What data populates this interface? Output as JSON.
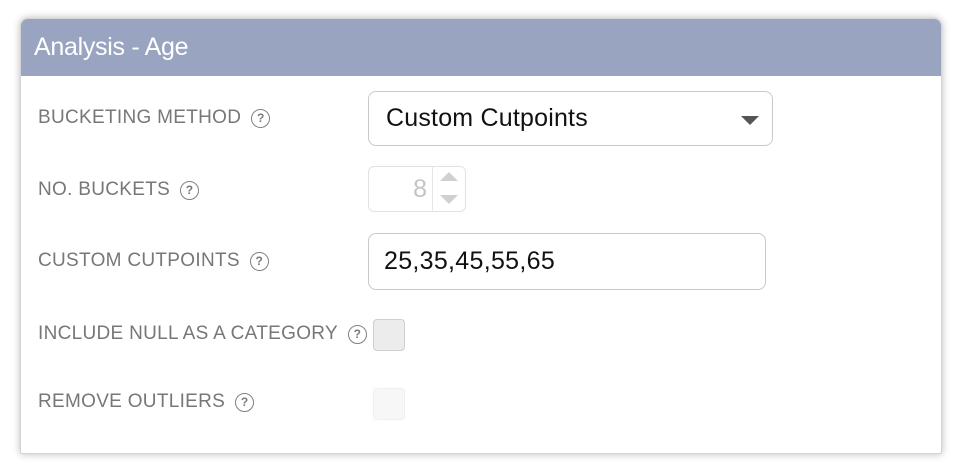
{
  "panel": {
    "title": "Analysis - Age"
  },
  "fields": {
    "bucketing_method": {
      "label": "BUCKETING METHOD",
      "help_glyph": "?",
      "value": "Custom Cutpoints"
    },
    "no_buckets": {
      "label": "NO. BUCKETS",
      "help_glyph": "?",
      "value": "8",
      "disabled": true
    },
    "custom_cutpoints": {
      "label": "CUSTOM CUTPOINTS",
      "help_glyph": "?",
      "value": "25,35,45,55,65"
    },
    "include_null": {
      "label": "INCLUDE NULL AS A CATEGORY",
      "help_glyph": "?",
      "checked": false
    },
    "remove_outliers": {
      "label": "REMOVE OUTLIERS",
      "help_glyph": "?",
      "checked": false,
      "disabled": true
    }
  },
  "icons": {
    "help": "help-circle-icon",
    "dropdown": "caret-down-icon",
    "step_up": "arrow-up-icon",
    "step_down": "arrow-down-icon"
  },
  "colors": {
    "header_bg": "#99a4c1",
    "label_text": "#777777"
  }
}
